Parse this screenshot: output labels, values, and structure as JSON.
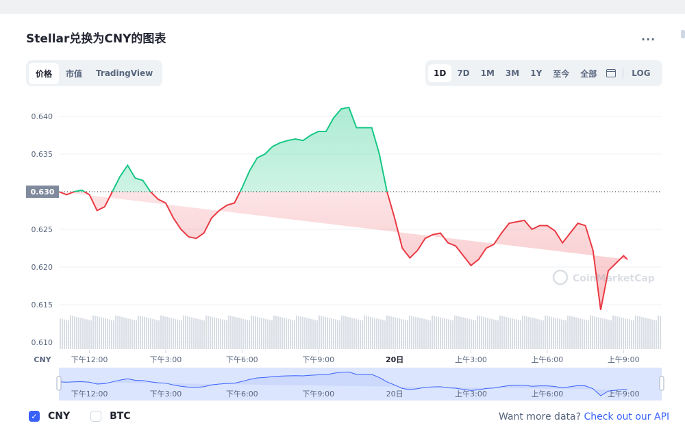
{
  "title": "Stellar兑换为CNY的图表",
  "more_label": "...",
  "tabs": [
    {
      "label": "价格",
      "active": true
    },
    {
      "label": "市值",
      "active": false
    },
    {
      "label": "TradingView",
      "active": false
    }
  ],
  "ranges": [
    {
      "label": "1D",
      "active": true
    },
    {
      "label": "7D",
      "active": false
    },
    {
      "label": "1M",
      "active": false
    },
    {
      "label": "3M",
      "active": false
    },
    {
      "label": "1Y",
      "active": false
    },
    {
      "label": "至今",
      "active": false
    },
    {
      "label": "全部",
      "active": false
    }
  ],
  "calendar_icon": "calendar-icon",
  "log_label": "LOG",
  "colors": {
    "up": "#16c784",
    "down": "#ea3943",
    "accent": "#3861fb",
    "navigator": "#dbe5fd"
  },
  "chart_data": {
    "type": "line",
    "currency_label": "CNY",
    "reference_price": 0.63,
    "reference_label": "0.630",
    "ylim": [
      0.61,
      0.642
    ],
    "yticks": [
      0.64,
      0.635,
      0.63,
      0.625,
      0.62,
      0.615,
      0.61
    ],
    "ytick_labels": [
      "0.640",
      "0.635",
      "0.630",
      "0.625",
      "0.620",
      "0.615",
      "0.610"
    ],
    "x_range_hours": [
      10.8,
      34.5
    ],
    "xticks": [
      {
        "hour": 12,
        "label": "下午12:00"
      },
      {
        "hour": 15,
        "label": "下午3:00"
      },
      {
        "hour": 18,
        "label": "下午6:00"
      },
      {
        "hour": 21,
        "label": "下午9:00"
      },
      {
        "hour": 24,
        "label": "20日"
      },
      {
        "hour": 27,
        "label": "上午3:00"
      },
      {
        "hour": 30,
        "label": "上午6:00"
      },
      {
        "hour": 33,
        "label": "上午9:00"
      }
    ],
    "x": [
      10.8,
      11.1,
      11.4,
      11.7,
      12.0,
      12.3,
      12.6,
      12.9,
      13.2,
      13.5,
      13.8,
      14.1,
      14.4,
      14.7,
      15.0,
      15.3,
      15.6,
      15.9,
      16.2,
      16.5,
      16.8,
      17.1,
      17.4,
      17.7,
      18.0,
      18.3,
      18.6,
      18.9,
      19.2,
      19.5,
      19.8,
      20.1,
      20.4,
      20.7,
      21.0,
      21.3,
      21.6,
      21.9,
      22.2,
      22.5,
      22.8,
      23.1,
      23.4,
      23.7,
      24.0,
      24.3,
      24.6,
      24.9,
      25.2,
      25.5,
      25.8,
      26.1,
      26.4,
      26.7,
      27.0,
      27.3,
      27.6,
      27.9,
      28.2,
      28.5,
      28.8,
      29.1,
      29.4,
      29.7,
      30.0,
      30.3,
      30.6,
      30.9,
      31.2,
      31.5,
      31.8,
      32.1,
      32.4,
      32.7,
      33.0,
      33.15,
      33.3,
      33.6,
      33.9,
      34.2,
      34.5
    ],
    "y": [
      0.63,
      0.6296,
      0.63,
      0.6302,
      0.6296,
      0.6275,
      0.628,
      0.63,
      0.632,
      0.6335,
      0.6318,
      0.6315,
      0.63,
      0.629,
      0.6285,
      0.6265,
      0.625,
      0.624,
      0.6238,
      0.6245,
      0.6265,
      0.6275,
      0.6282,
      0.6285,
      0.6305,
      0.6328,
      0.6345,
      0.635,
      0.636,
      0.6365,
      0.6368,
      0.637,
      0.6368,
      0.6375,
      0.638,
      0.638,
      0.6398,
      0.641,
      0.6412,
      0.6385,
      0.6385,
      0.6385,
      0.635,
      0.63,
      0.6265,
      0.6225,
      0.6212,
      0.6222,
      0.6238,
      0.6243,
      0.6245,
      0.6232,
      0.6228,
      0.6215,
      0.6202,
      0.621,
      0.6225,
      0.623,
      0.6245,
      0.6258,
      0.626,
      0.6262,
      0.625,
      0.6255,
      0.6255,
      0.6248,
      0.6232,
      0.6245,
      0.6258,
      0.6255,
      0.6222,
      0.6143,
      0.6195,
      0.6205,
      0.6215,
      0.621
    ],
    "volume_label": "",
    "navigator_labels": [
      "下午12:00",
      "下午3:00",
      "下午6:00",
      "下午9:00",
      "20日",
      "上午3:00",
      "上午6:00",
      "上午9:00"
    ]
  },
  "watermark": "CoinMarketCap",
  "legend": [
    {
      "label": "CNY",
      "checked": true
    },
    {
      "label": "BTC",
      "checked": false
    }
  ],
  "cta_text": "Want more data? ",
  "cta_link": "Check out our API"
}
